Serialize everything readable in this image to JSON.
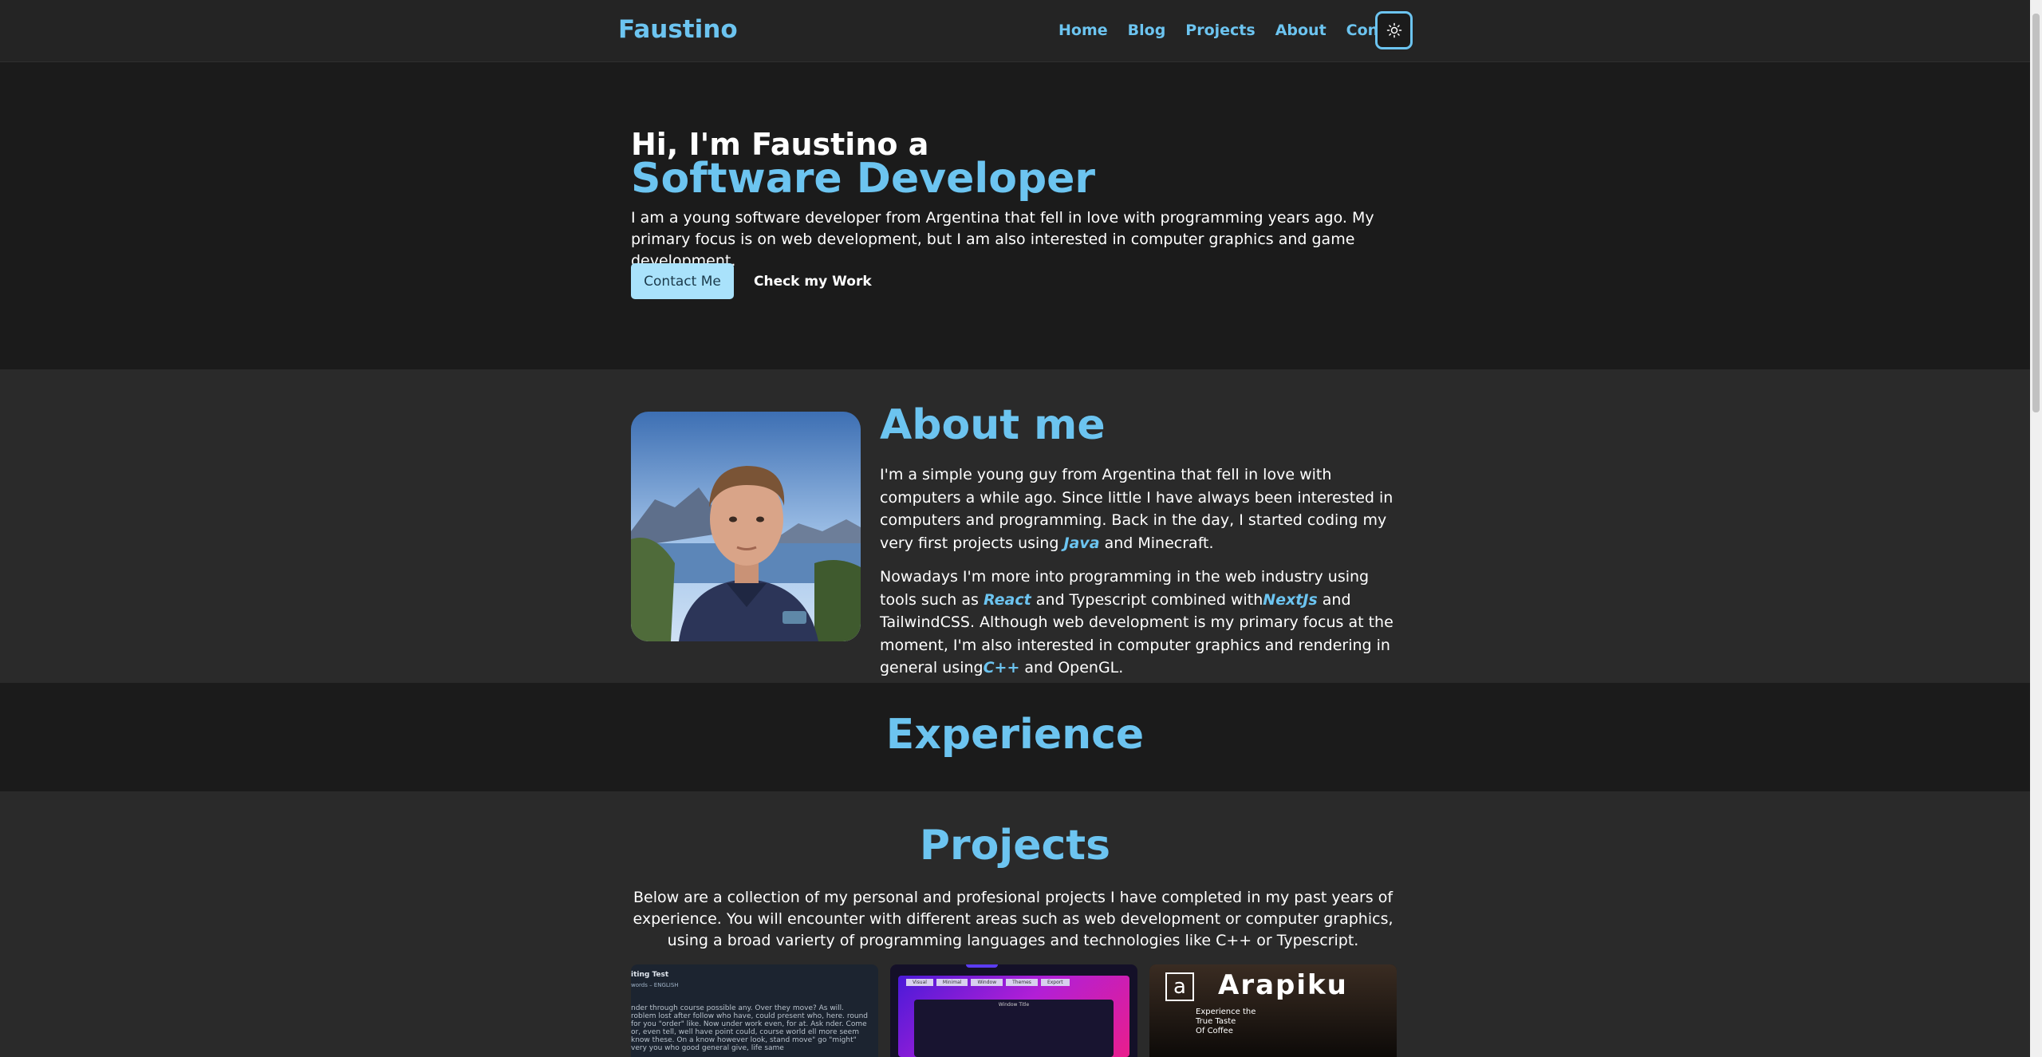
{
  "nav": {
    "brand": "Faustino",
    "links": [
      "Home",
      "Blog",
      "Projects",
      "About",
      "Contact"
    ],
    "theme_icon": "sun-icon"
  },
  "hero": {
    "greeting": "Hi, I'm Faustino a",
    "role": "Software Developer",
    "description": "I am a young software developer from Argentina that fell in love with programming years ago. My primary focus is on web development, but I am also interested in computer graphics and game development.",
    "contact_button": "Contact Me",
    "work_button": "Check my Work"
  },
  "about": {
    "title": "About me",
    "p1_before": "I'm a simple young guy from Argentina that fell in love with computers a while ago. Since little I have always been interested in computers and programming. Back in the day, I started coding my very first projects using ",
    "p1_tech": "Java",
    "p1_after": " and Minecraft.",
    "p2_a": "Nowadays I'm more into programming in the web industry using tools such as ",
    "p2_tech1": "React",
    "p2_b": " and Typescript combined with",
    "p2_tech2": "NextJs",
    "p2_c": " and TailwindCSS. Although web development is my primary focus at the moment, I'm also interested in computer graphics and rendering in general using",
    "p2_tech3": "C++",
    "p2_d": " and OpenGL."
  },
  "experience": {
    "title": "Experience"
  },
  "projects": {
    "title": "Projects",
    "description": "Below are a collection of my personal and profesional projects I have completed in my past years of experience. You will encounter with different areas such as web development or computer graphics, using a broad varierty of programming languages and technologies like C++ or Typescript.",
    "cards": [
      {
        "heading": "iting Test",
        "subheading": "words – ENGLISH",
        "text": "nder through course possible any. Over they move? As will. roblem lost after follow who have, could present who, here. round for you \"order\" like. Now under work even, for at. Ask nder. Come or, even tell, well have point could, course world ell more seem know these. On a know however look, stand move\" go \"might\" very you who good general give, life same"
      },
      {
        "menu": [
          "Visual",
          "Minimal",
          "Window",
          "Themes",
          "Export"
        ],
        "window_title": "Window Title"
      },
      {
        "logo": "Arapiku",
        "tagline_1": "Experience the",
        "tagline_2": "True Taste",
        "tagline_3": "Of Coffee"
      }
    ]
  }
}
